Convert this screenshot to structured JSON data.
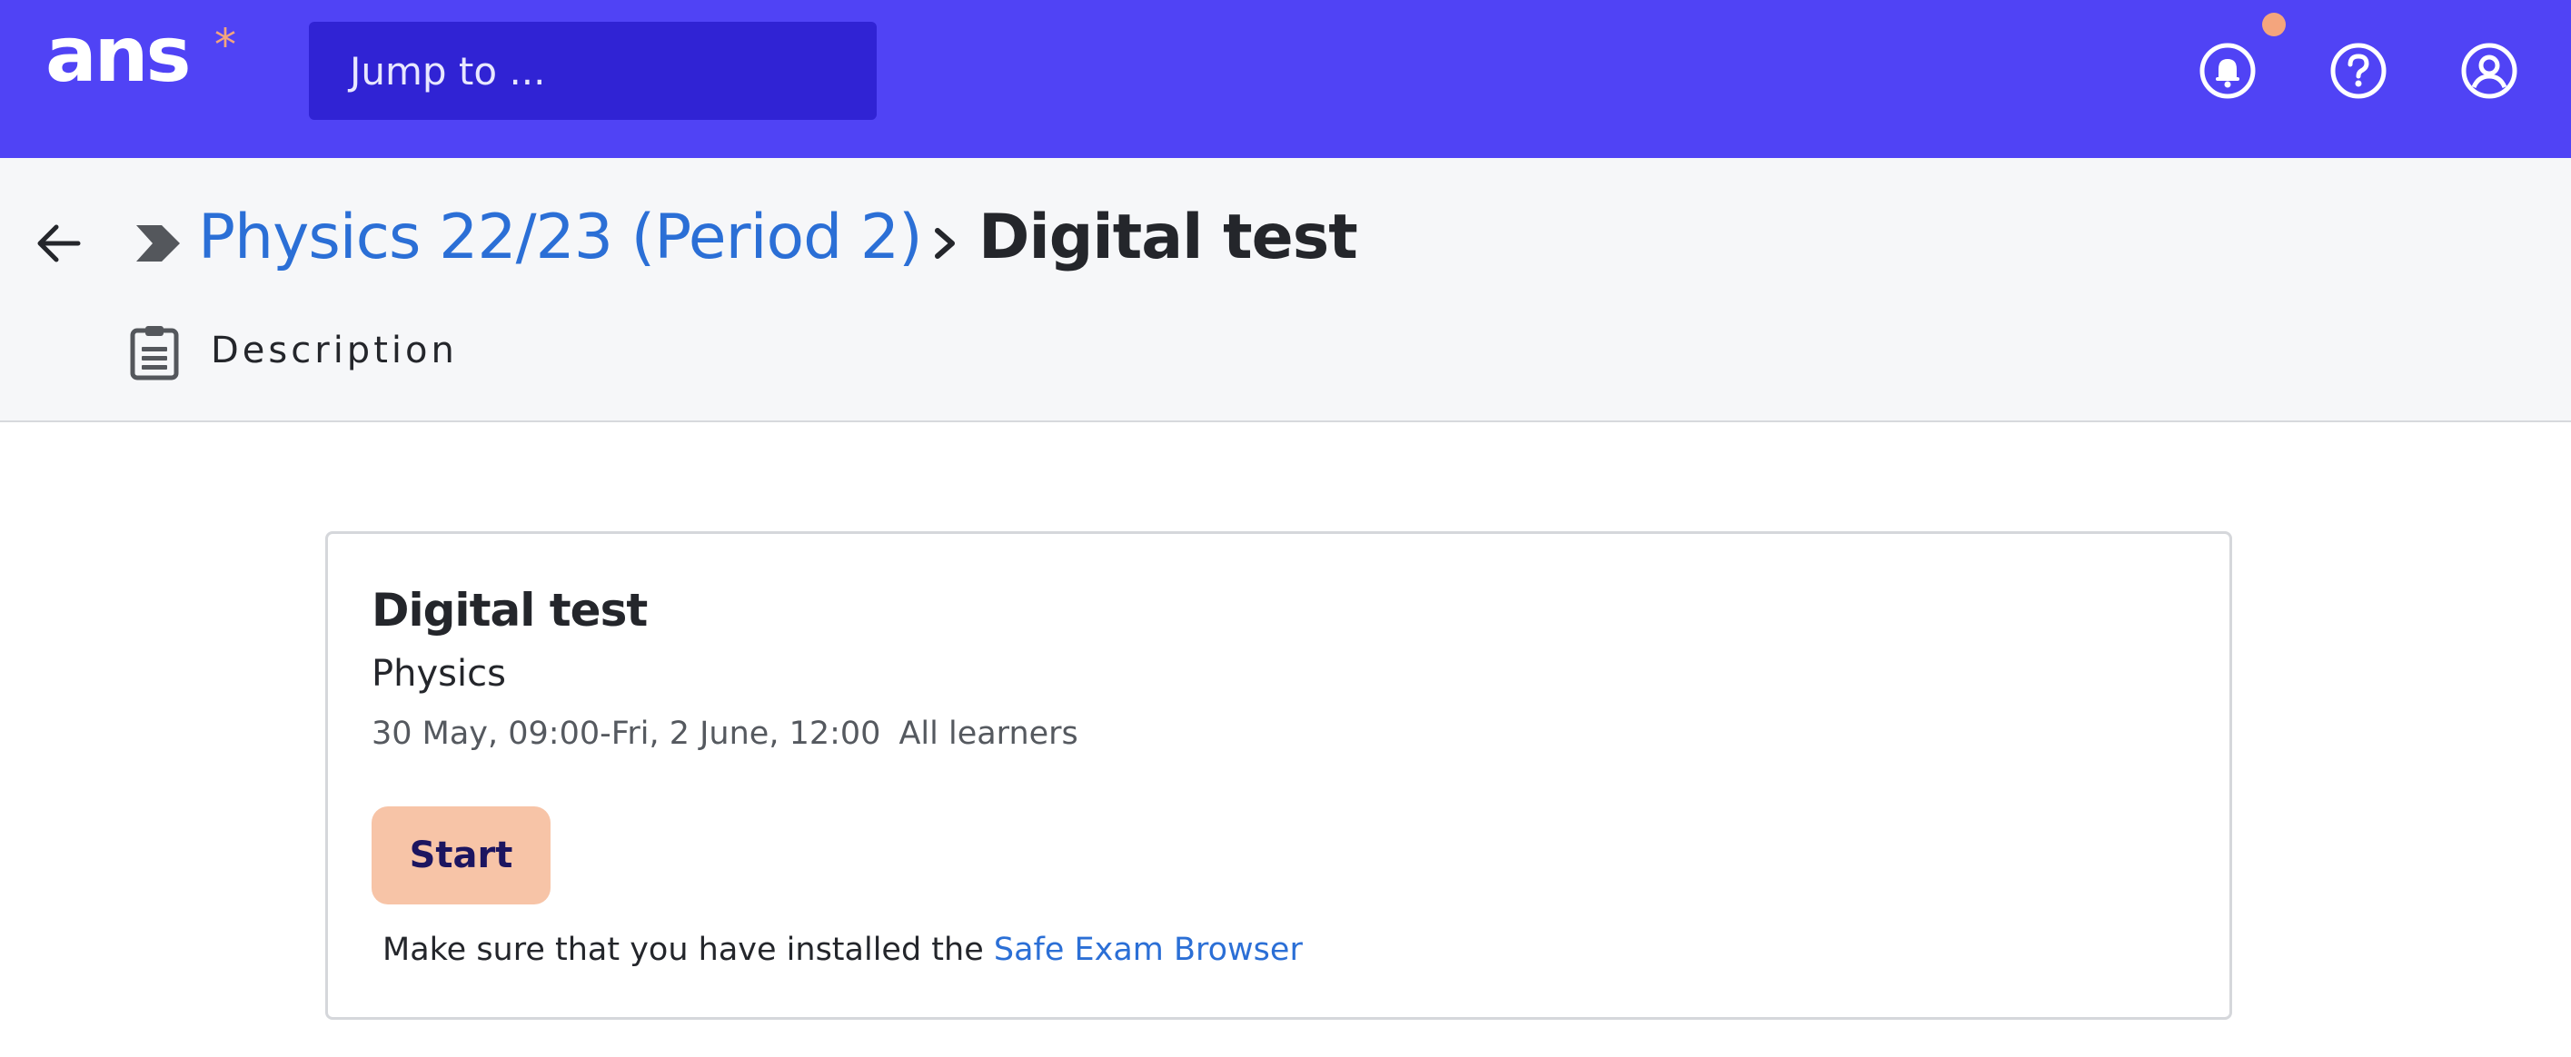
{
  "header": {
    "logo_text": "ans",
    "logo_star": "*",
    "jump_placeholder": "Jump to ...",
    "icons": [
      "bell-icon",
      "help-icon",
      "account-icon"
    ],
    "colors": {
      "bar": "#5043f5",
      "jump_box": "#3023d4",
      "accent": "#f4a57d"
    }
  },
  "breadcrumb": {
    "course": "Physics 22/23 (Period 2)",
    "separator": ">",
    "current": "Digital test"
  },
  "subnav": {
    "description_label": "Description"
  },
  "card": {
    "title": "Digital test",
    "subject": "Physics",
    "schedule": "30 May, 09:00-Fri, 2 June, 12:00",
    "audience": "All learners",
    "start_label": "Start",
    "note_prefix": "Make sure that you have installed the ",
    "note_link": "Safe Exam Browser"
  }
}
